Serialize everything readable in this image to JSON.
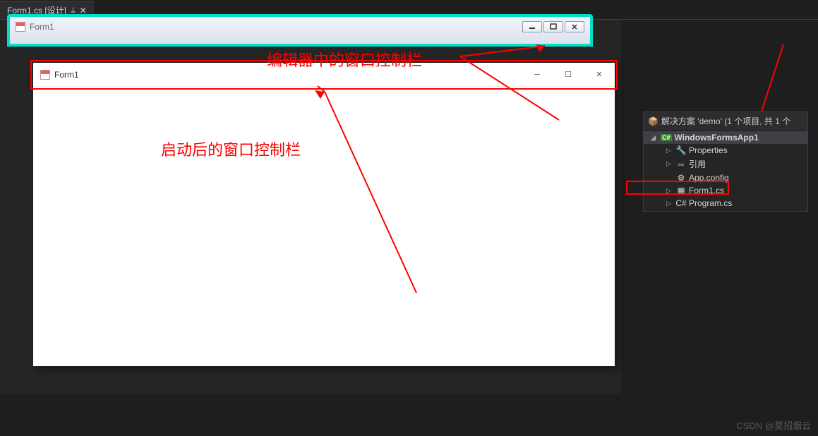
{
  "tab": {
    "label": "Form1.cs [设计]"
  },
  "editorForm": {
    "title": "Form1"
  },
  "runForm": {
    "title": "Form1"
  },
  "annotations": {
    "editorLabel": "编辑器中的窗口控制栏",
    "runLabel": "启动后的窗口控制栏"
  },
  "solutionExplorer": {
    "header": "解决方案 'demo' (1 个项目, 共 1 个",
    "project": "WindowsFormsApp1",
    "items": {
      "properties": "Properties",
      "references": "引用",
      "appconfig": "App.config",
      "form1": "Form1.cs",
      "program": "Program.cs"
    }
  },
  "watermark": "CSDN @莫招烟云"
}
